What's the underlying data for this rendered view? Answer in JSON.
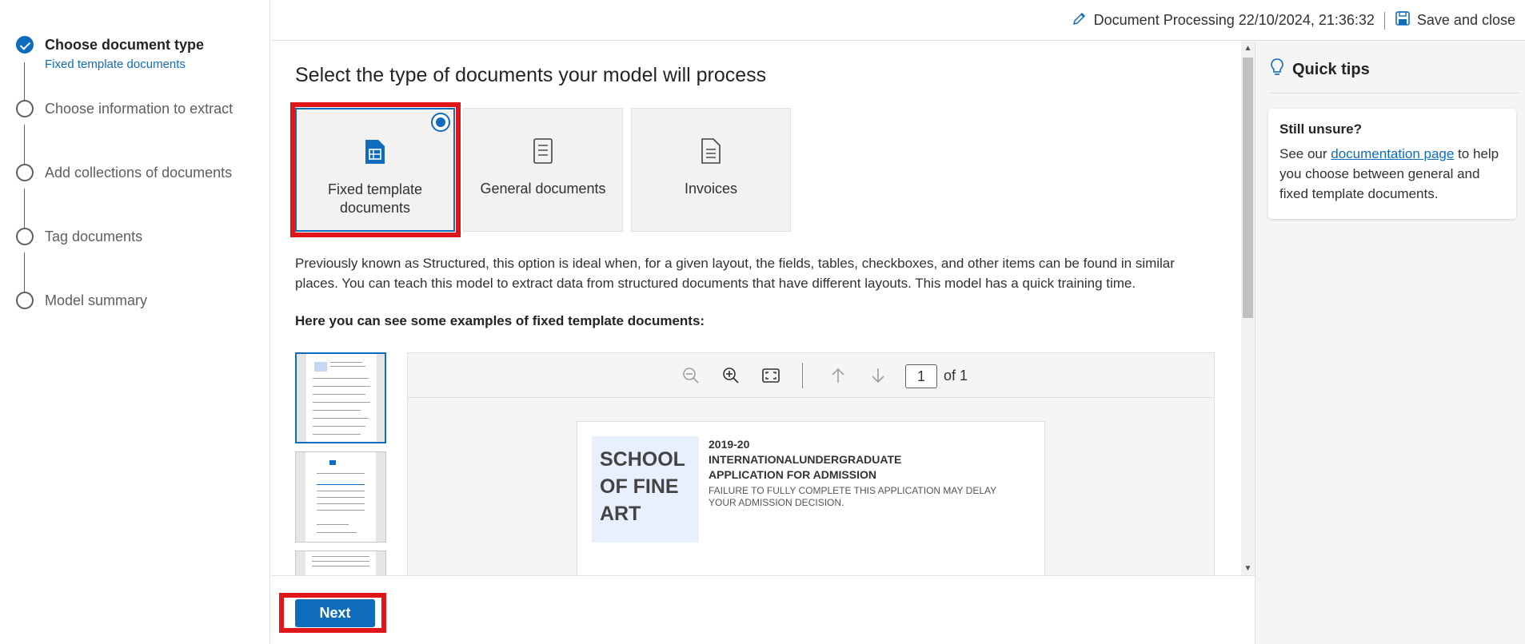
{
  "steps": [
    {
      "label": "Choose document type",
      "sub": "Fixed template documents",
      "state": "done"
    },
    {
      "label": "Choose information to extract"
    },
    {
      "label": "Add collections of documents"
    },
    {
      "label": "Tag documents"
    },
    {
      "label": "Model summary"
    }
  ],
  "topbar": {
    "doc_title": "Document Processing 22/10/2024, 21:36:32",
    "save_label": "Save and close"
  },
  "main": {
    "heading": "Select the type of documents your model will process",
    "cards": [
      {
        "label": "Fixed template documents",
        "icon": "table-document-icon",
        "selected": true
      },
      {
        "label": "General documents",
        "icon": "document-lines-icon",
        "selected": false
      },
      {
        "label": "Invoices",
        "icon": "invoice-icon",
        "selected": false
      }
    ],
    "description": "Previously known as Structured, this option is ideal when, for a given layout, the fields, tables, checkboxes, and other items can be found in similar places. You can teach this model to extract data from structured documents that have different layouts. This model has a quick training time.",
    "examples_title": "Here you can see some examples of fixed template documents:"
  },
  "viewer": {
    "page_value": "1",
    "page_of": "of 1",
    "doc": {
      "logo_text": "SCHOOL OF FINE ART",
      "year": "2019-20",
      "title1": "INTERNATIONALUNDERGRADUATE",
      "title2": "APPLICATION FOR ADMISSION",
      "note": "FAILURE TO FULLY COMPLETE THIS APPLICATION MAY DELAY YOUR ADMISSION DECISION."
    }
  },
  "footer": {
    "next_label": "Next"
  },
  "tips": {
    "title": "Quick tips",
    "card_heading": "Still unsure?",
    "card_pre": "See our ",
    "card_link": "documentation page",
    "card_post": " to help you choose between general and fixed template documents."
  },
  "colors": {
    "accent": "#0f6cbd",
    "highlight": "#e0161b"
  }
}
